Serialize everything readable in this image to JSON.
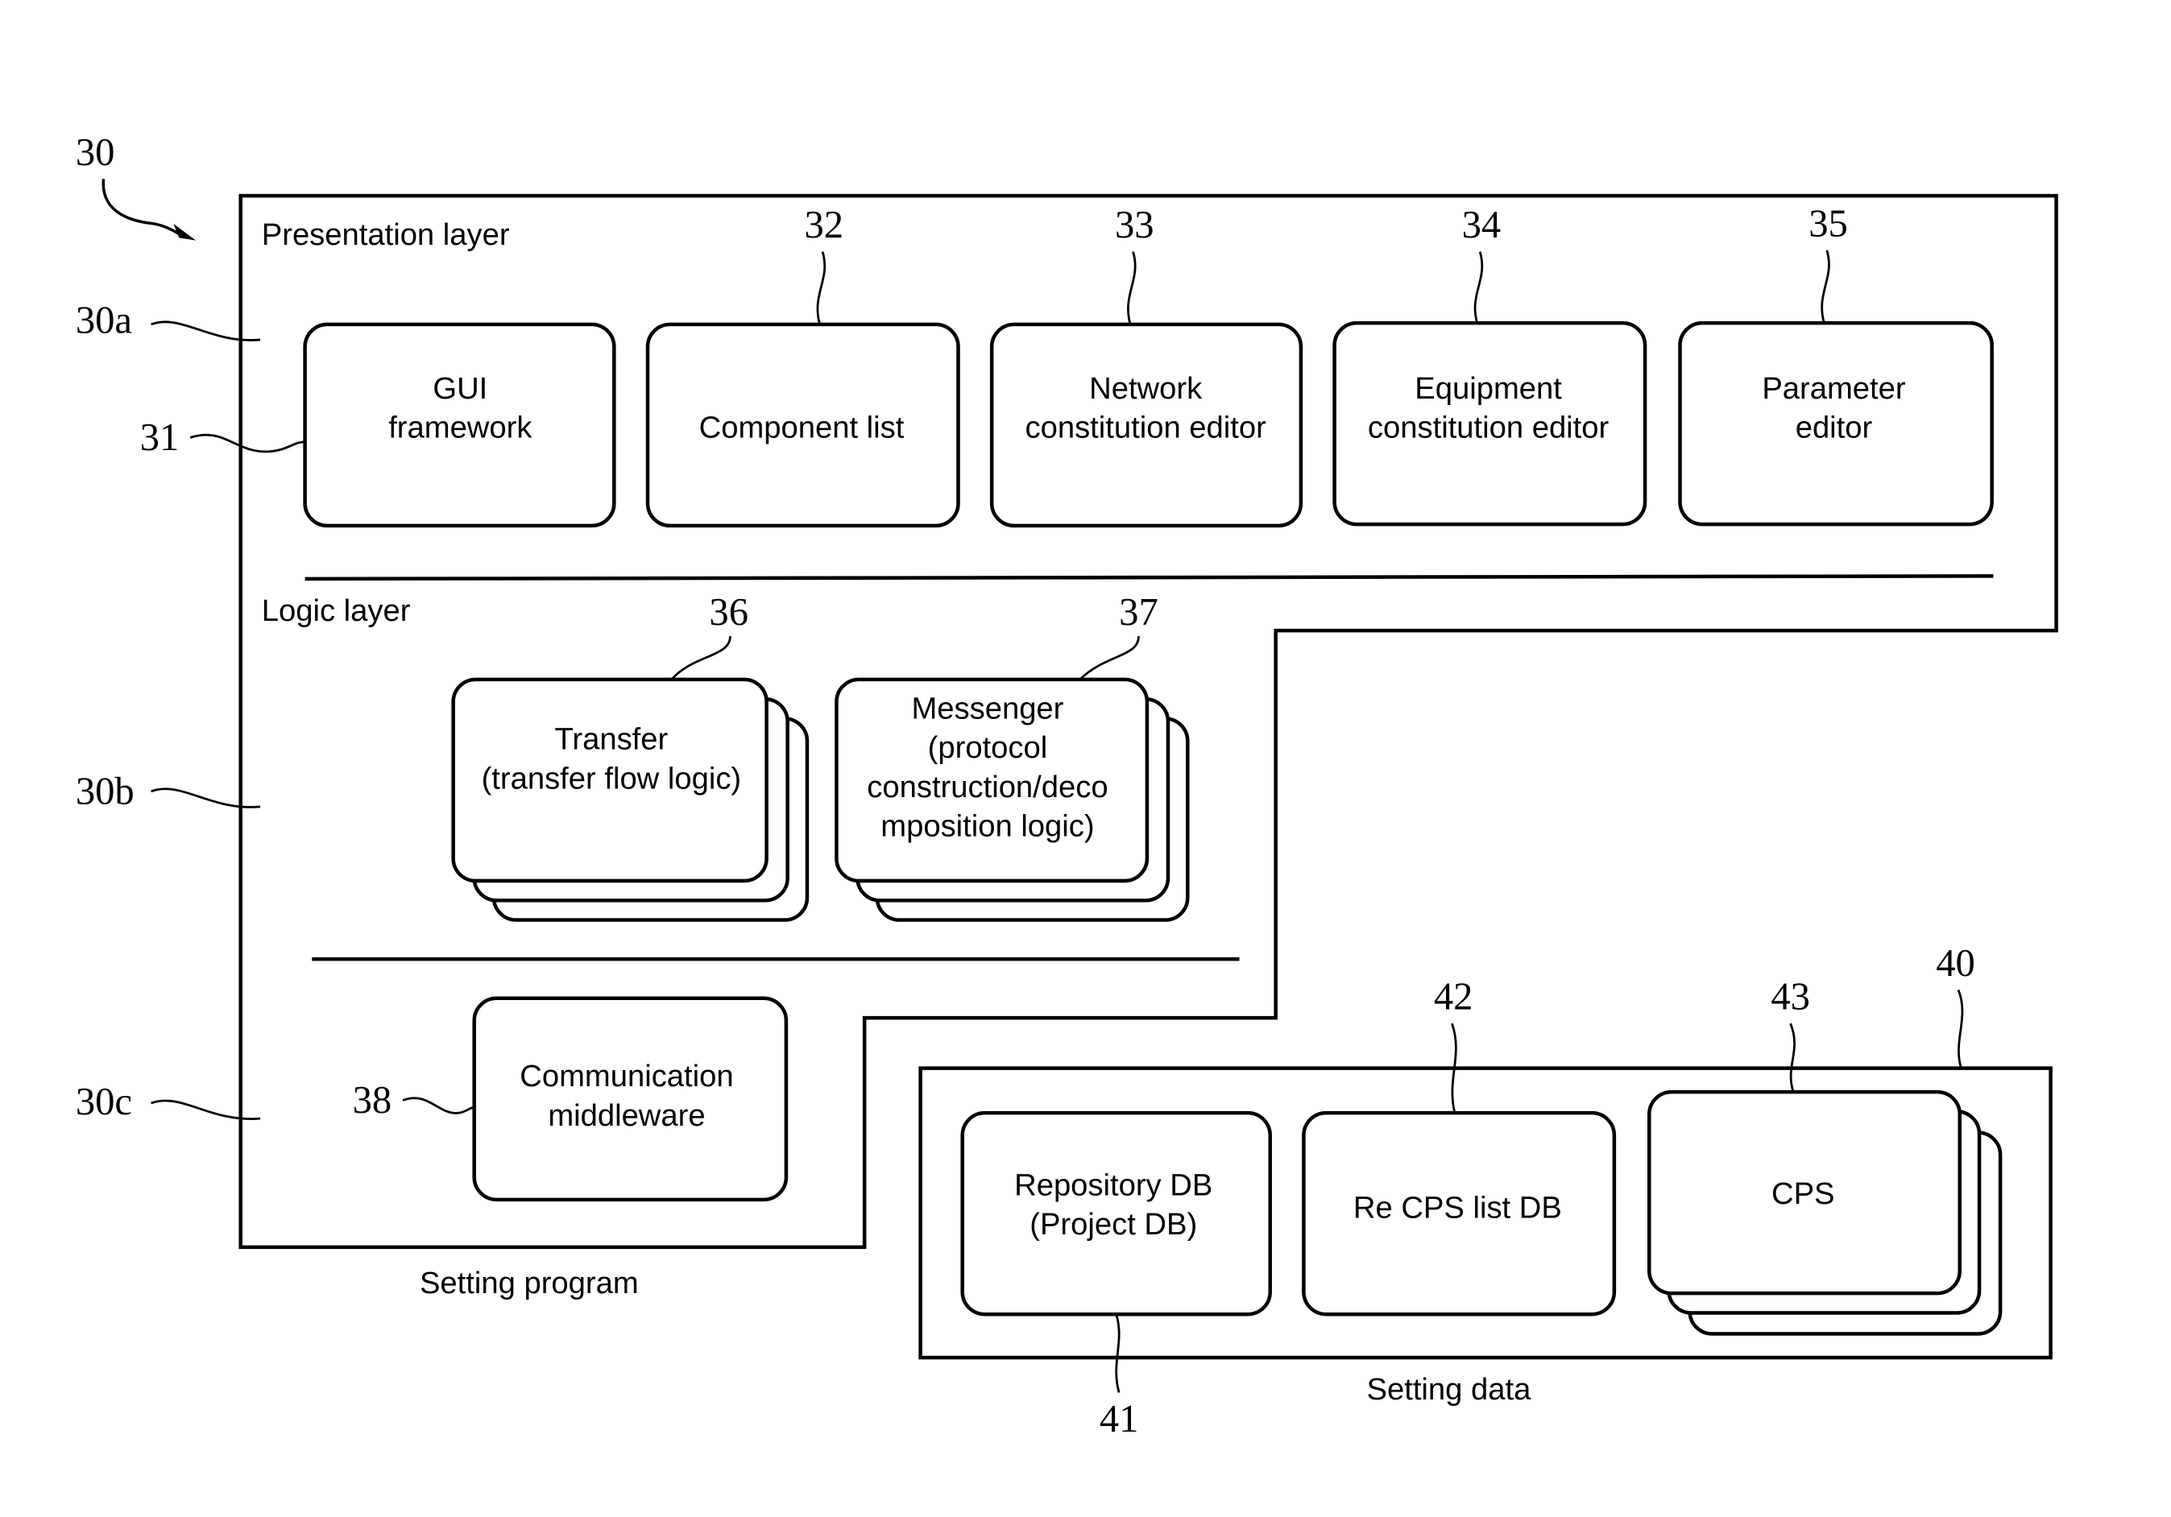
{
  "figure": {
    "ref": "30",
    "setting_program": {
      "caption": "Setting program",
      "layers": {
        "presentation": {
          "ref": "30a",
          "title": "Presentation layer"
        },
        "logic": {
          "ref": "30b",
          "title": "Logic layer"
        },
        "communication": {
          "ref": "30c"
        }
      },
      "presentation_blocks": [
        {
          "ref": "31",
          "lines": [
            "GUI",
            "framework"
          ]
        },
        {
          "ref": "32",
          "lines": [
            "Component list"
          ]
        },
        {
          "ref": "33",
          "lines": [
            "Network",
            "constitution editor"
          ]
        },
        {
          "ref": "34",
          "lines": [
            "Equipment",
            "constitution editor"
          ]
        },
        {
          "ref": "35",
          "lines": [
            "Parameter",
            "editor"
          ]
        }
      ],
      "logic_blocks": [
        {
          "ref": "36",
          "lines": [
            "Transfer",
            "(transfer flow logic)"
          ]
        },
        {
          "ref": "37",
          "lines": [
            "Messenger",
            "(protocol",
            "construction/deco",
            "mposition logic)"
          ]
        }
      ],
      "communication_block": {
        "ref": "38",
        "lines": [
          "Communication",
          "middleware"
        ]
      }
    },
    "setting_data": {
      "ref": "40",
      "caption": "Setting data",
      "blocks": [
        {
          "ref": "41",
          "lines": [
            "Repository DB",
            "(Project DB)"
          ]
        },
        {
          "ref": "42",
          "lines": [
            "Re CPS list DB"
          ]
        },
        {
          "ref": "43",
          "lines": [
            "CPS"
          ]
        }
      ]
    }
  }
}
